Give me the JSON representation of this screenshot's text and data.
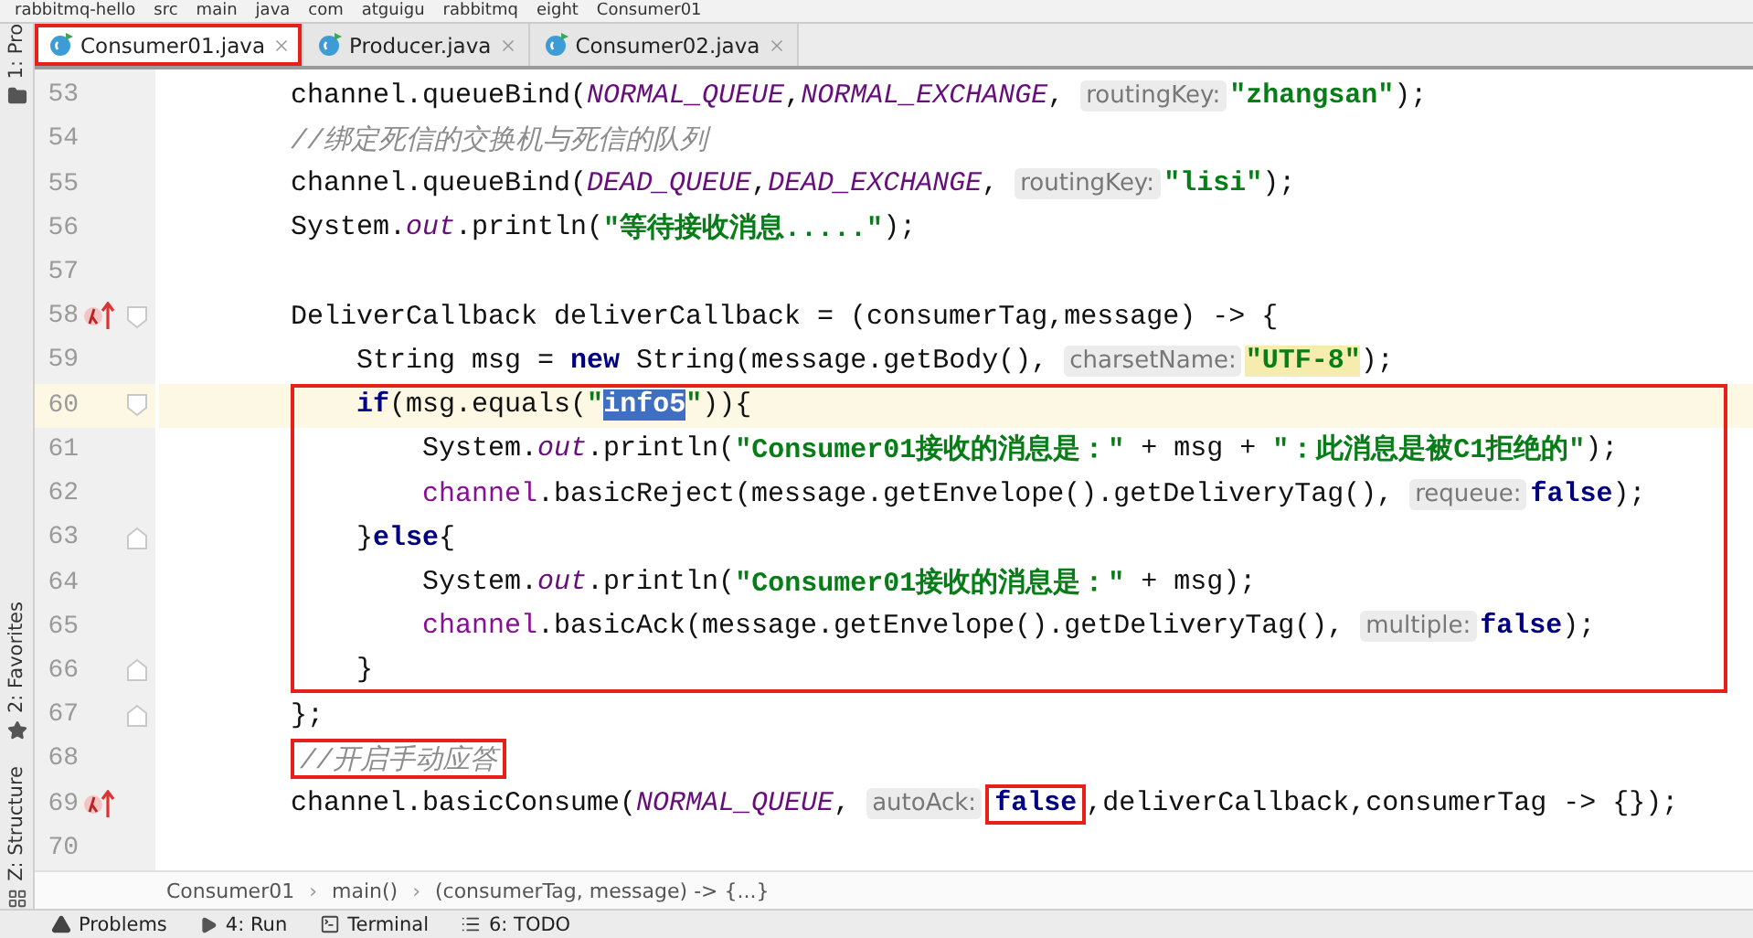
{
  "path_bar": {
    "items": [
      "rabbitmq-hello",
      "src",
      "main",
      "java",
      "com",
      "atguigu",
      "rabbitmq",
      "eight",
      "Consumer01"
    ]
  },
  "tabs": [
    {
      "label": "Consumer01.java",
      "selected": true,
      "boxed": true
    },
    {
      "label": "Producer.java",
      "selected": false,
      "boxed": false
    },
    {
      "label": "Consumer02.java",
      "selected": false,
      "boxed": false
    }
  ],
  "side_tools": [
    {
      "label": "1: Pro",
      "kind": "project"
    },
    {
      "label": "2: Favorites",
      "kind": "favorites"
    },
    {
      "label": "Z: Structure",
      "kind": "structure"
    }
  ],
  "lines": [
    {
      "number": "53",
      "tokens": [
        {
          "kind": "plain",
          "text": "channel.queueBind("
        },
        {
          "kind": "constant",
          "text": "NORMAL_QUEUE"
        },
        {
          "kind": "plain",
          "text": ","
        },
        {
          "kind": "constant",
          "text": "NORMAL_EXCHANGE"
        },
        {
          "kind": "plain",
          "text": ", "
        },
        {
          "kind": "hint",
          "text": "routingKey:"
        },
        {
          "kind": "string",
          "text": "\"zhangsan\""
        },
        {
          "kind": "plain",
          "text": ");"
        }
      ]
    },
    {
      "number": "54",
      "tokens": [
        {
          "kind": "comment",
          "text": "//绑定死信的交换机与死信的队列"
        }
      ]
    },
    {
      "number": "55",
      "tokens": [
        {
          "kind": "plain",
          "text": "channel.queueBind("
        },
        {
          "kind": "constant",
          "text": "DEAD_QUEUE"
        },
        {
          "kind": "plain",
          "text": ","
        },
        {
          "kind": "constant",
          "text": "DEAD_EXCHANGE"
        },
        {
          "kind": "plain",
          "text": ", "
        },
        {
          "kind": "hint",
          "text": "routingKey:"
        },
        {
          "kind": "string",
          "text": "\"lisi\""
        },
        {
          "kind": "plain",
          "text": ");"
        }
      ]
    },
    {
      "number": "56",
      "tokens": [
        {
          "kind": "plain",
          "text": "System."
        },
        {
          "kind": "constant",
          "text": "out"
        },
        {
          "kind": "plain",
          "text": ".println("
        },
        {
          "kind": "string",
          "text": "\"等待接收消息.....\""
        },
        {
          "kind": "plain",
          "text": ");"
        }
      ]
    },
    {
      "number": "57"
    },
    {
      "number": "58",
      "lambda_marker": true,
      "fold_start": true,
      "tokens": [
        {
          "kind": "plain",
          "text": "DeliverCallback deliverCallback = (consumerTag,message) -> {"
        }
      ]
    },
    {
      "number": "59",
      "tokens": [
        {
          "kind": "plain",
          "text": "    String msg = "
        },
        {
          "kind": "keyword",
          "text": "new"
        },
        {
          "kind": "plain",
          "text": " String(message.getBody(), "
        },
        {
          "kind": "hint",
          "text": "charsetName:"
        },
        {
          "kind": "string",
          "text": "\"UTF-8\"",
          "highlighted": true
        },
        {
          "kind": "plain",
          "text": ");"
        }
      ]
    },
    {
      "number": "60",
      "current": true,
      "boxed": true,
      "fold_start": true,
      "tokens": [
        {
          "kind": "keyword",
          "text": "    if"
        },
        {
          "kind": "plain",
          "text": "(msg.equals("
        },
        {
          "kind": "string",
          "text": "\""
        },
        {
          "kind": "selection",
          "text": "info5"
        },
        {
          "kind": "string",
          "text": "\""
        },
        {
          "kind": "plain",
          "text": ")){"
        }
      ]
    },
    {
      "number": "61",
      "boxed": true,
      "tokens": [
        {
          "kind": "plain",
          "text": "        System."
        },
        {
          "kind": "constant",
          "text": "out"
        },
        {
          "kind": "plain",
          "text": ".println("
        },
        {
          "kind": "string",
          "text": "\"Consumer01接收的消息是：\""
        },
        {
          "kind": "plain",
          "text": " + msg + "
        },
        {
          "kind": "string",
          "text": "\"：此消息是被C1拒绝的\""
        },
        {
          "kind": "plain",
          "text": ");"
        }
      ]
    },
    {
      "number": "62",
      "boxed": true,
      "tokens": [
        {
          "kind": "field",
          "text": "        channel"
        },
        {
          "kind": "plain",
          "text": ".basicReject(message.getEnvelope().getDeliveryTag(), "
        },
        {
          "kind": "hint",
          "text": "requeue:"
        },
        {
          "kind": "keyword",
          "text": "false"
        },
        {
          "kind": "plain",
          "text": ");"
        }
      ]
    },
    {
      "number": "63",
      "boxed": true,
      "fold_end": true,
      "tokens": [
        {
          "kind": "plain",
          "text": "    }"
        },
        {
          "kind": "keyword",
          "text": "else"
        },
        {
          "kind": "plain",
          "text": "{"
        }
      ]
    },
    {
      "number": "64",
      "boxed": true,
      "tokens": [
        {
          "kind": "plain",
          "text": "        System."
        },
        {
          "kind": "constant",
          "text": "out"
        },
        {
          "kind": "plain",
          "text": ".println("
        },
        {
          "kind": "string",
          "text": "\"Consumer01接收的消息是：\""
        },
        {
          "kind": "plain",
          "text": " + msg);"
        }
      ]
    },
    {
      "number": "65",
      "boxed": true,
      "tokens": [
        {
          "kind": "field",
          "text": "        channel"
        },
        {
          "kind": "plain",
          "text": ".basicAck(message.getEnvelope().getDeliveryTag(), "
        },
        {
          "kind": "hint",
          "text": "multiple:"
        },
        {
          "kind": "keyword",
          "text": "false"
        },
        {
          "kind": "plain",
          "text": ");"
        }
      ]
    },
    {
      "number": "66",
      "boxed": true,
      "fold_end": true,
      "tokens": [
        {
          "kind": "plain",
          "text": "    }"
        }
      ]
    },
    {
      "number": "67",
      "fold_end": true,
      "tokens": [
        {
          "kind": "plain",
          "text": "};"
        }
      ]
    },
    {
      "number": "68",
      "tokens": [
        {
          "kind": "comment",
          "text": "//开启手动应答",
          "boxed": true
        }
      ]
    },
    {
      "number": "69",
      "lambda_marker": true,
      "tokens": [
        {
          "kind": "plain",
          "text": "channel.basicConsume("
        },
        {
          "kind": "constant",
          "text": "NORMAL_QUEUE"
        },
        {
          "kind": "plain",
          "text": ", "
        },
        {
          "kind": "hint",
          "text": "autoAck:"
        },
        {
          "kind": "keyword",
          "text": "false",
          "boxed": true
        },
        {
          "kind": "plain",
          "text": ",deliverCallback,consumerTag -> {});"
        }
      ]
    },
    {
      "number": "70"
    }
  ],
  "breadcrumb": {
    "separator": "›",
    "items": [
      "Consumer01",
      "main()",
      "(consumerTag, message) -> {...}"
    ]
  },
  "tool_windows": [
    {
      "label": "Problems",
      "kind": "problems"
    },
    {
      "label": "4: Run",
      "kind": "run"
    },
    {
      "label": "Terminal",
      "kind": "terminal"
    },
    {
      "label": "6: TODO",
      "kind": "todo"
    }
  ]
}
